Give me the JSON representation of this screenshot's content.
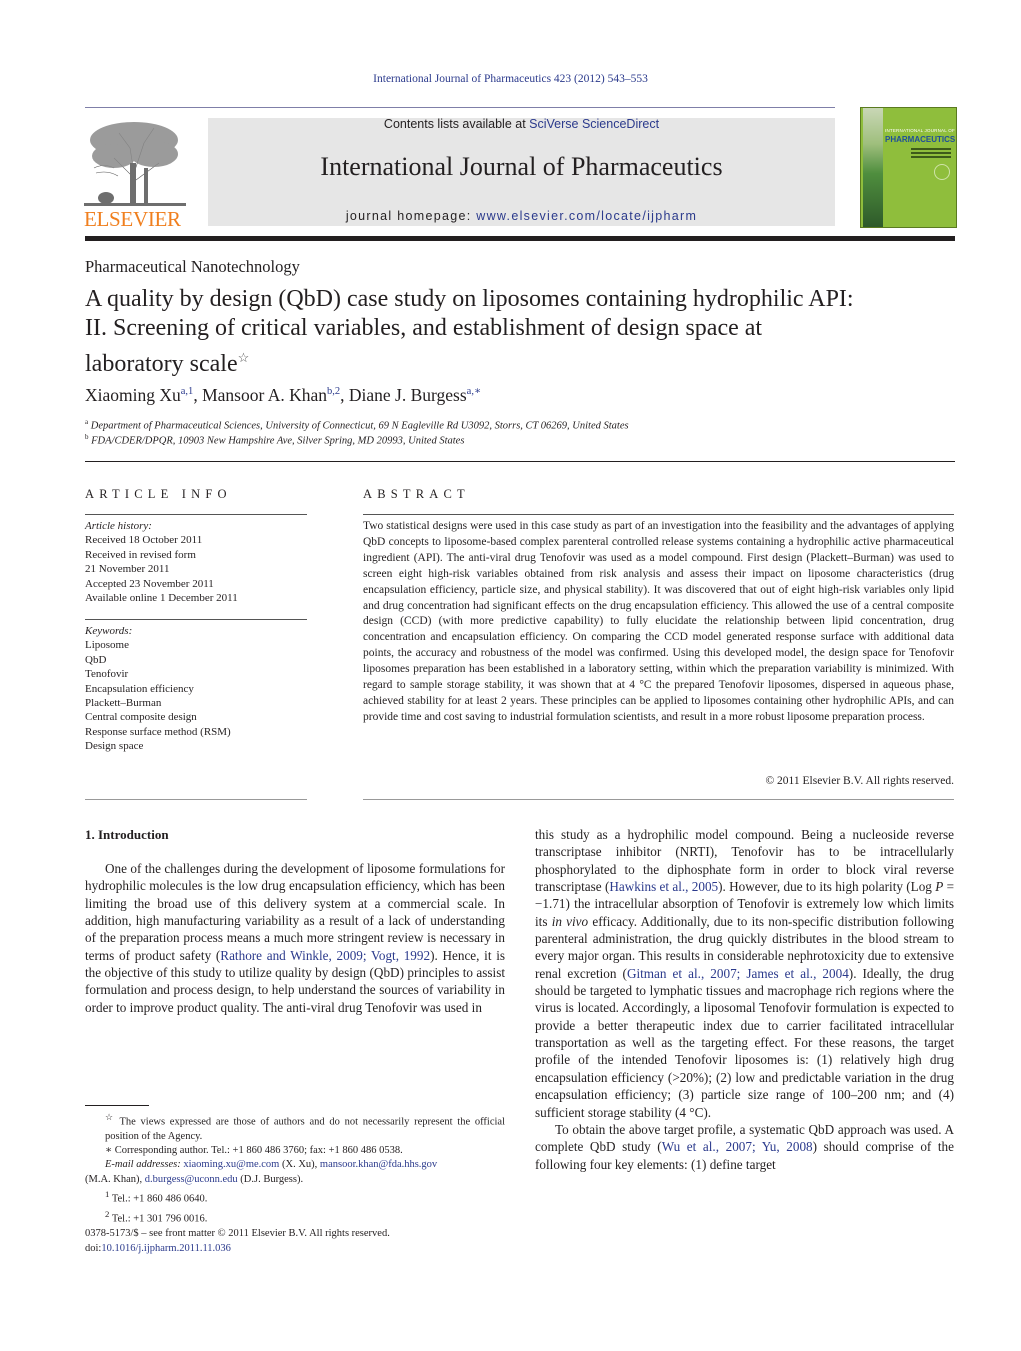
{
  "header": {
    "journal_reference": "International Journal of Pharmaceutics 423 (2012) 543–553",
    "contents_prefix": "Contents lists available at ",
    "contents_link": "SciVerse ScienceDirect",
    "journal_title": "International Journal of Pharmaceutics",
    "homepage_prefix": "journal homepage: ",
    "homepage_link": "www.elsevier.com/locate/ijpharm",
    "publisher_logo_text": "ELSEVIER",
    "cover": {
      "top_text": "INTERNATIONAL JOURNAL OF",
      "main_text": "PHARMACEUTICS"
    },
    "colors": {
      "link": "#2b3a8c",
      "elsevier_orange": "#f07f1e",
      "cover_green": "#8fbe3c",
      "header_box": "#e6e6e6"
    }
  },
  "article": {
    "section": "Pharmaceutical Nanotechnology",
    "title_lines": [
      "A quality by design (QbD) case study on liposomes containing hydrophilic API:",
      "II. Screening of critical variables, and establishment of design space at",
      "laboratory scale"
    ],
    "title_mark": "☆",
    "authors": [
      {
        "name": "Xiaoming Xu",
        "marks": "a,1"
      },
      {
        "name": "Mansoor A. Khan",
        "marks": "b,2"
      },
      {
        "name": "Diane J. Burgess",
        "marks": "a,∗"
      }
    ],
    "affiliations": [
      {
        "mark": "a",
        "text": "Department of Pharmaceutical Sciences, University of Connecticut, 69 N Eagleville Rd U3092, Storrs, CT 06269, United States"
      },
      {
        "mark": "b",
        "text": "FDA/CDER/DPQR, 10903 New Hampshire Ave, Silver Spring, MD 20993, United States"
      }
    ]
  },
  "article_info": {
    "heading": "ARTICLE INFO",
    "history_label": "Article history:",
    "history": [
      "Received 18 October 2011",
      "Received in revised form",
      "21 November 2011",
      "Accepted 23 November 2011",
      "Available online 1 December 2011"
    ],
    "keywords_label": "Keywords:",
    "keywords": [
      "Liposome",
      "QbD",
      "Tenofovir",
      "Encapsulation efficiency",
      "Plackett–Burman",
      "Central composite design",
      "Response surface method (RSM)",
      "Design space"
    ]
  },
  "abstract": {
    "heading": "ABSTRACT",
    "text": "Two statistical designs were used in this case study as part of an investigation into the feasibility and the advantages of applying QbD concepts to liposome-based complex parenteral controlled release systems containing a hydrophilic active pharmaceutical ingredient (API). The anti-viral drug Tenofovir was used as a model compound. First design (Plackett–Burman) was used to screen eight high-risk variables obtained from risk analysis and assess their impact on liposome characteristics (drug encapsulation efficiency, particle size, and physical stability). It was discovered that out of eight high-risk variables only lipid and drug concentration had significant effects on the drug encapsulation efficiency. This allowed the use of a central composite design (CCD) (with more predictive capability) to fully elucidate the relationship between lipid concentration, drug concentration and encapsulation efficiency. On comparing the CCD model generated response surface with additional data points, the accuracy and robustness of the model was confirmed. Using this developed model, the design space for Tenofovir liposomes preparation has been established in a laboratory setting, within which the preparation variability is minimized. With regard to sample storage stability, it was shown that at 4 °C the prepared Tenofovir liposomes, dispersed in aqueous phase, achieved stability for at least 2 years. These principles can be applied to liposomes containing other hydrophilic APIs, and can provide time and cost saving to industrial formulation scientists, and result in a more robust liposome preparation process.",
    "copyright": "© 2011 Elsevier B.V. All rights reserved."
  },
  "introduction": {
    "heading": "1.  Introduction",
    "left_p1_before": "One of the challenges during the development of liposome formulations for hydrophilic molecules is the low drug encapsulation efficiency, which has been limiting the broad use of this delivery system at a commercial scale. In addition, high manufacturing variability as a result of a lack of understanding of the preparation process means a much more stringent review is necessary in terms of product safety (",
    "left_p1_cite": "Rathore and Winkle, 2009; Vogt, 1992",
    "left_p1_after": "). Hence, it is the objective of this study to utilize quality by design (QbD) principles to assist formulation and process design, to help understand the sources of variability in order to improve product quality. The anti-viral drug Tenofovir was used in",
    "right_p1_a": "this study as a hydrophilic model compound. Being a nucleoside reverse transcriptase inhibitor (NRTI), Tenofovir has to be intracellularly phosphorylated to the diphosphate form in order to block viral reverse transcriptase (",
    "right_p1_cite1": "Hawkins et al., 2005",
    "right_p1_b": "). However, due to its high polarity (Log ",
    "right_p1_p": "P",
    "right_p1_c": " = −1.71) the intracellular absorption of Tenofovir is extremely low which limits its ",
    "right_p1_invivo": "in vivo",
    "right_p1_d": " efficacy. Additionally, due to its non-specific distribution following parenteral administration, the drug quickly distributes in the blood stream to every major organ. This results in considerable nephrotoxicity due to extensive renal excretion (",
    "right_p1_cite2": "Gitman et al., 2007; James et al., 2004",
    "right_p1_e": "). Ideally, the drug should be targeted to lymphatic tissues and macrophage rich regions where the virus is located. Accordingly, a liposomal Tenofovir formulation is expected to provide a better therapeutic index due to carrier facilitated intracellular transportation as well as the targeting effect. For these reasons, the target profile of the intended Tenofovir liposomes is: (1) relatively high drug encapsulation efficiency (>20%); (2) low and predictable variation in the drug encapsulation efficiency; (3) particle size range of 100–200 nm; and (4) sufficient storage stability (4 °C).",
    "right_p2_a": "To obtain the above target profile, a systematic QbD approach was used. A complete QbD study (",
    "right_p2_cite": "Wu et al., 2007; Yu, 2008",
    "right_p2_b": ") should comprise of the following four key elements: (1) define target"
  },
  "footnotes": {
    "star_mark": "☆",
    "star_text": "The views expressed are those of authors and do not necessarily represent the official position of the Agency.",
    "corresponding_mark": "∗",
    "corresponding_text": "Corresponding author. Tel.: +1 860 486 3760; fax: +1 860 486 0538.",
    "email_label": "E-mail addresses:",
    "emails": [
      {
        "address": "xiaoming.xu@me.com",
        "owner": "(X. Xu),"
      },
      {
        "address": "mansoor.khan@fda.hhs.gov",
        "owner": "(M.A. Khan),"
      },
      {
        "address": "d.burgess@uconn.edu",
        "owner": "(D.J. Burgess)."
      }
    ],
    "fn1_mark": "1",
    "fn1_text": "Tel.: +1 860 486 0640.",
    "fn2_mark": "2",
    "fn2_text": "Tel.: +1 301 796 0016."
  },
  "front_matter": {
    "issn_line": "0378-5173/$ – see front matter © 2011 Elsevier B.V. All rights reserved.",
    "doi_prefix": "doi:",
    "doi": "10.1016/j.ijpharm.2011.11.036"
  }
}
